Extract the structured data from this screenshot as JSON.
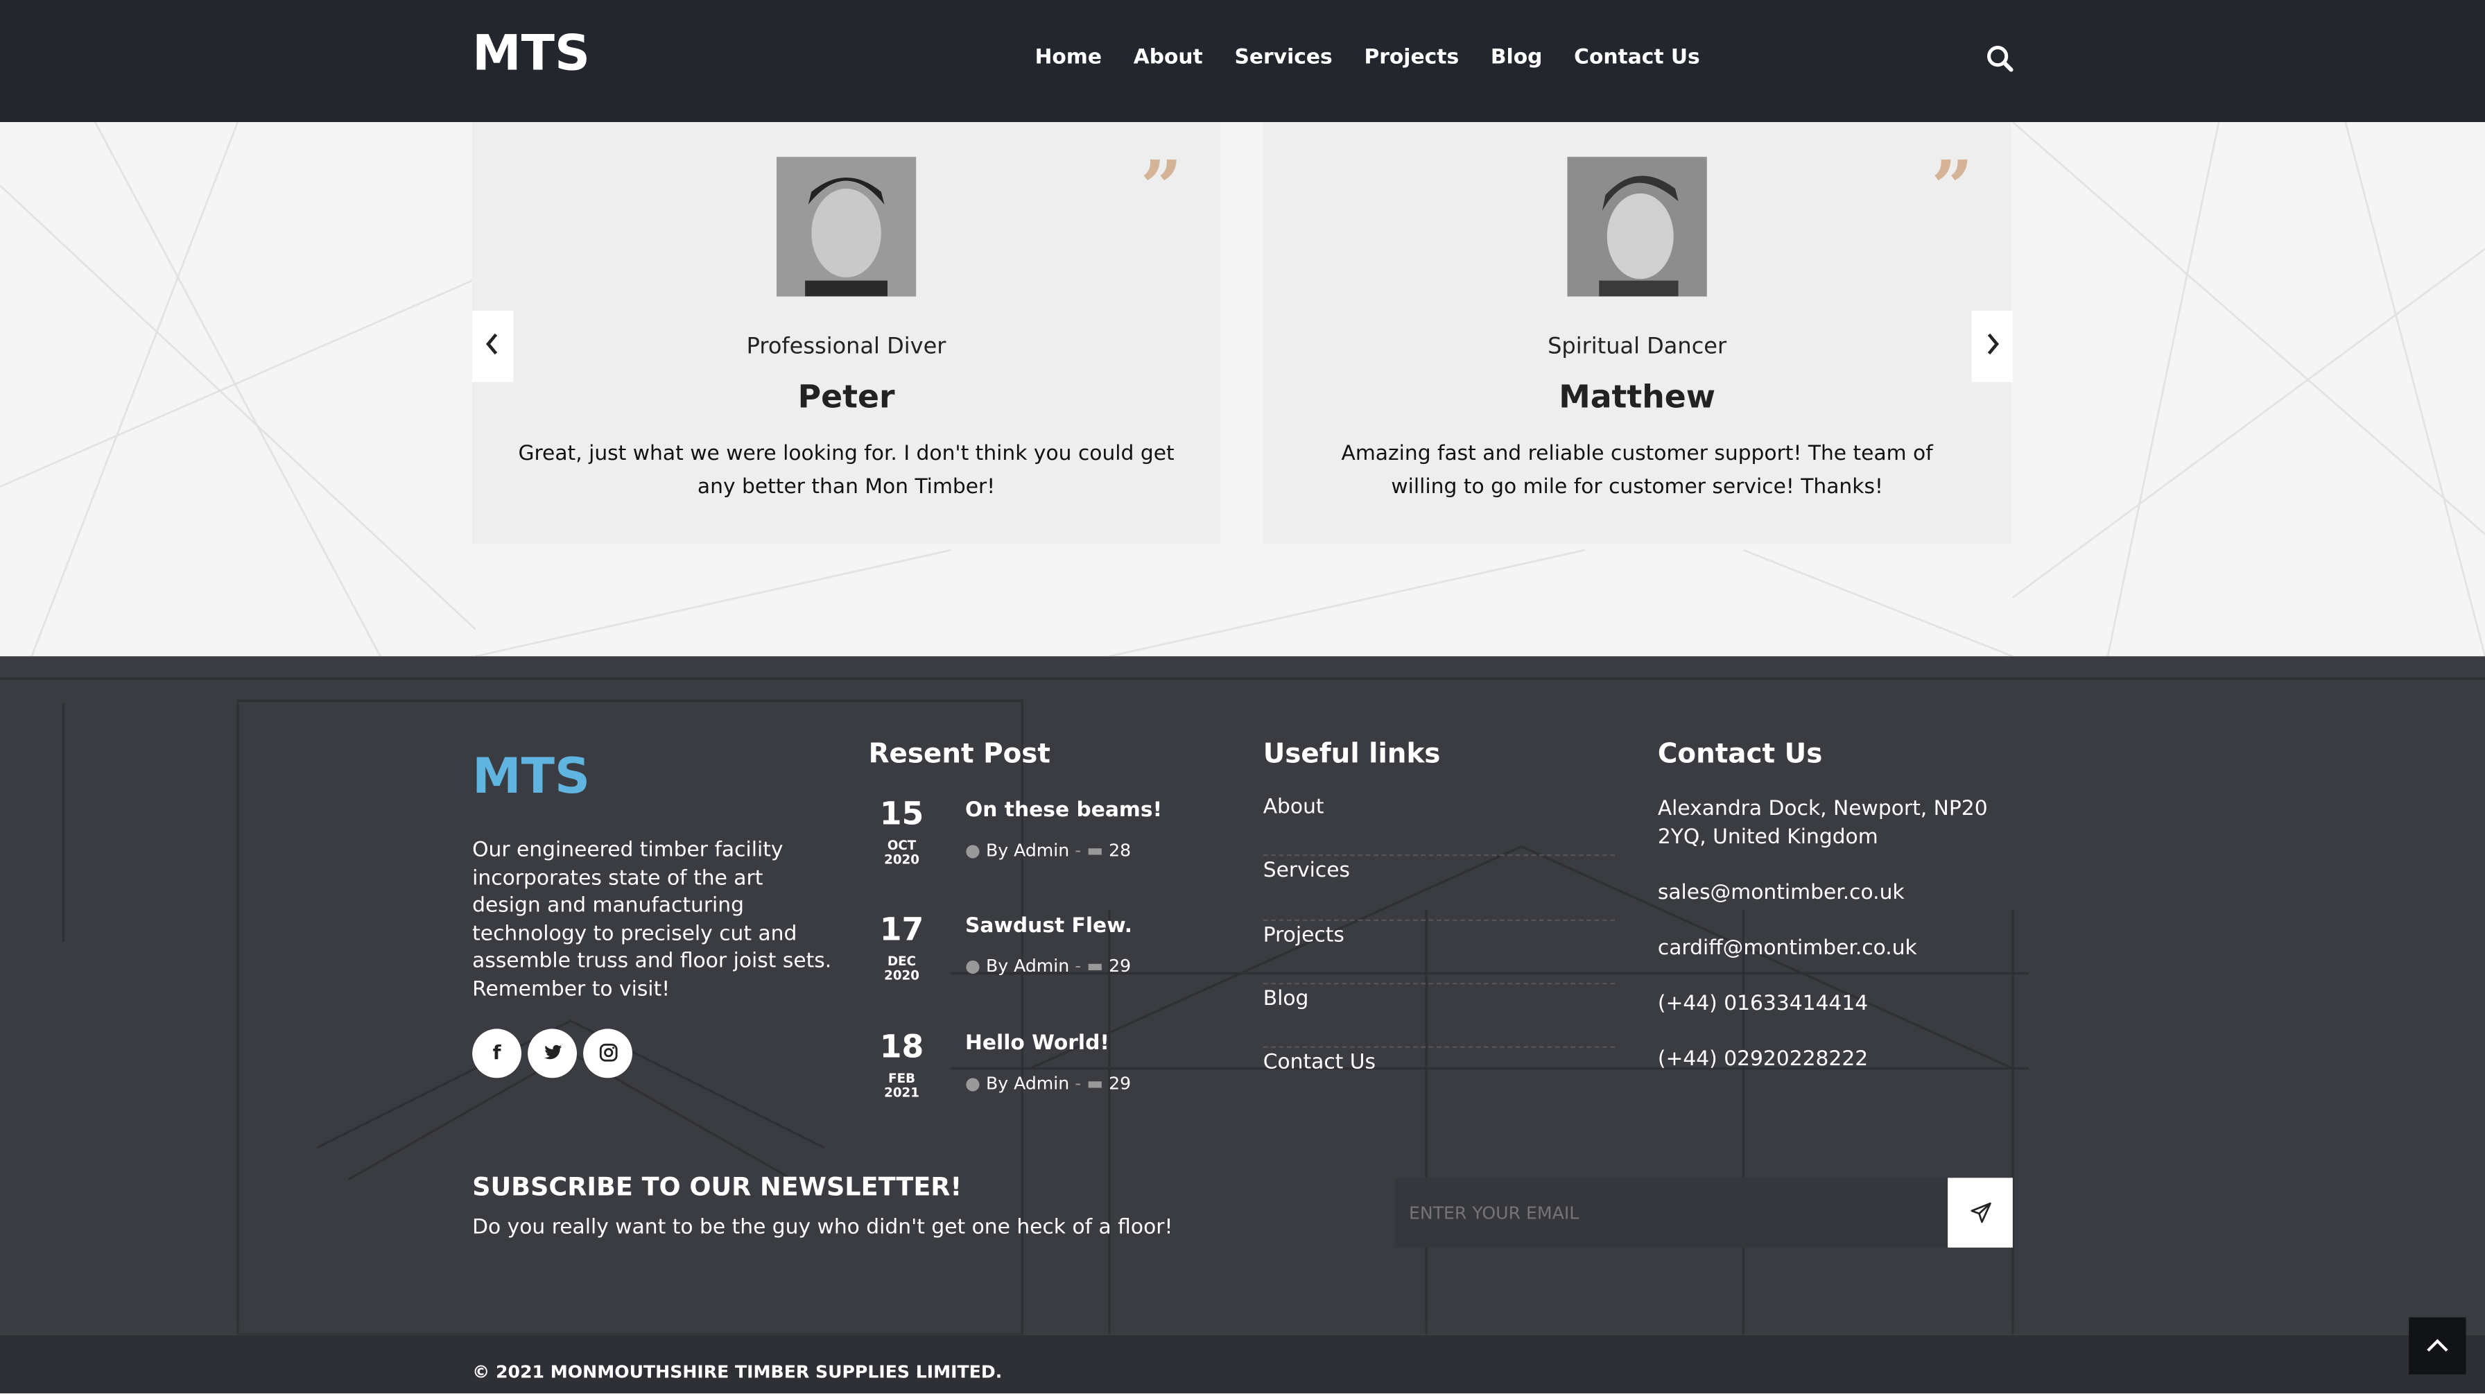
{
  "header": {
    "logo": "MTS",
    "nav": [
      "Home",
      "About",
      "Services",
      "Projects",
      "Blog",
      "Contact Us"
    ]
  },
  "testimonials": [
    {
      "role": "Professional Diver",
      "name": "Peter",
      "text": "Great, just what we were looking for. I don't think you could get any better than Mon Timber!"
    },
    {
      "role": "Spiritual Dancer",
      "name": "Matthew",
      "text": "Amazing fast and reliable customer support! The team of willing to go mile for customer service! Thanks!"
    }
  ],
  "footer": {
    "logo": "MTS",
    "about": "Our engineered timber facility incorporates state of the art design and manufacturing technology to precisely cut and assemble truss and floor joist sets. Remember to visit!",
    "recent_heading": "Resent Post",
    "posts": [
      {
        "day": "15",
        "month": "OCT 2020",
        "title": "On these beams!",
        "author": "By Admin",
        "comments": "28"
      },
      {
        "day": "17",
        "month": "DEC 2020",
        "title": "Sawdust Flew.",
        "author": "By Admin",
        "comments": "29"
      },
      {
        "day": "18",
        "month": "FEB 2021",
        "title": "Hello World!",
        "author": "By Admin",
        "comments": "29"
      }
    ],
    "links_heading": "Useful links",
    "links": [
      "About",
      "Services",
      "Projects",
      "Blog",
      "Contact Us"
    ],
    "contact_heading": "Contact Us",
    "contact": [
      "Alexandra Dock, Newport, NP20 2YQ, United Kingdom",
      "sales@montimber.co.uk",
      "cardiff@montimber.co.uk",
      "(+44) 01633414414",
      "(+44) 02920228222"
    ],
    "newsletter_title": "SUBSCRIBE TO OUR NEWSLETTER!",
    "newsletter_sub": "Do you really want to be the guy who didn't get one heck of a floor!",
    "email_placeholder": "ENTER YOUR EMAIL",
    "copyright": "© 2021 MONMOUTHSHIRE TIMBER SUPPLIES LIMITED.",
    "social_icons": [
      "facebook-icon",
      "twitter-icon",
      "instagram-icon"
    ]
  },
  "colors": {
    "header_bg": "#23262d",
    "footer_bg": "#3a3c41",
    "accent_logo": "#5fb5e0",
    "quote": "#d4b396"
  }
}
